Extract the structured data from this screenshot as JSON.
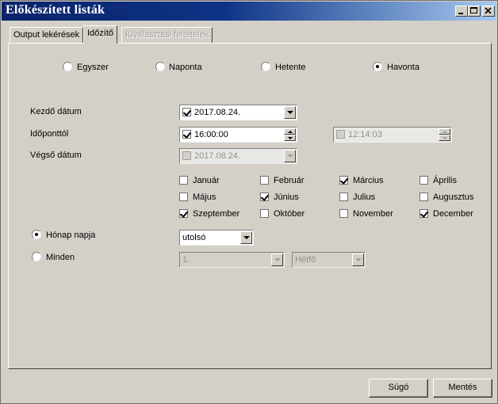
{
  "window": {
    "title": "Előkészített listák"
  },
  "title_buttons": {
    "minimize": "minimize-icon",
    "maximize": "maximize-icon",
    "close": "close-icon"
  },
  "tabs": [
    {
      "label": "Output lekérések",
      "active": false,
      "enabled": true
    },
    {
      "label": "Időzítő",
      "active": true,
      "enabled": true
    },
    {
      "label": "Kiválasztási feltételek",
      "active": false,
      "enabled": false
    }
  ],
  "frequency": {
    "options": [
      "Egyszer",
      "Naponta",
      "Hetente",
      "Havonta"
    ],
    "selected": "Havonta"
  },
  "start_date": {
    "label": "Kezdő dátum",
    "checked": true,
    "value": "2017.08.24."
  },
  "from_time": {
    "label": "Időponttól",
    "checked": true,
    "value": "16:00:00",
    "second_checked": false,
    "second_value": "12:14:03"
  },
  "end_date": {
    "label": "Végső dátum",
    "checked": false,
    "value": "2017.08.24."
  },
  "months": [
    {
      "label": "Január",
      "checked": false
    },
    {
      "label": "Február",
      "checked": false
    },
    {
      "label": "Március",
      "checked": true
    },
    {
      "label": "Április",
      "checked": false
    },
    {
      "label": "Május",
      "checked": false
    },
    {
      "label": "Június",
      "checked": true
    },
    {
      "label": "Julius",
      "checked": false
    },
    {
      "label": "Augusztus",
      "checked": false
    },
    {
      "label": "Szeptember",
      "checked": true
    },
    {
      "label": "Október",
      "checked": false
    },
    {
      "label": "November",
      "checked": false
    },
    {
      "label": "December",
      "checked": true
    }
  ],
  "day_of_month": {
    "label": "Hónap napja",
    "selected": true,
    "value": "utolsó"
  },
  "every": {
    "label": "Minden",
    "selected": false,
    "value1": "1.",
    "value2": "Hétfő"
  },
  "buttons": {
    "help": "Súgó",
    "save": "Mentés"
  }
}
